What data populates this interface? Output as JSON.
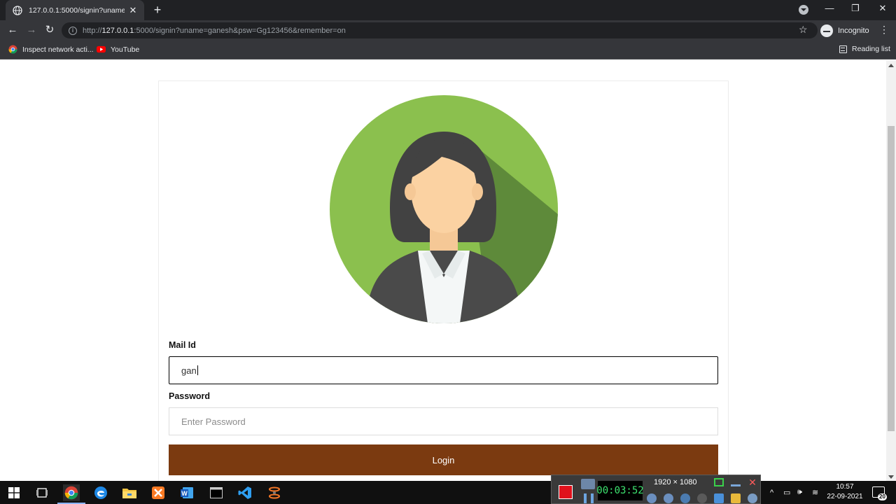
{
  "browser": {
    "tab_title": "127.0.0.1:5000/signin?uname=gan",
    "new_tab": "+",
    "url_prefix": "http://",
    "url_host": "127.0.0.1",
    "url_rest": ":5000/signin?uname=ganesh&psw=Gg123456&remember=on",
    "profile_label": "Incognito",
    "bookmarks": [
      {
        "label": "Inspect network acti..."
      },
      {
        "label": "YouTube"
      }
    ],
    "reading_list": "Reading list"
  },
  "form": {
    "mail_label": "Mail Id",
    "mail_value": "gan",
    "password_label": "Password",
    "password_placeholder": "Enter Password",
    "login_label": "Login"
  },
  "recorder": {
    "timer": "00:03:52",
    "resolution": "1920 × 1080"
  },
  "taskbar": {
    "time": "10:57",
    "date": "22-09-2021",
    "notification_count": "20"
  },
  "colors": {
    "login_button": "#7b3a10",
    "avatar_green": "#8bc04e",
    "browser_dark": "#202124"
  }
}
